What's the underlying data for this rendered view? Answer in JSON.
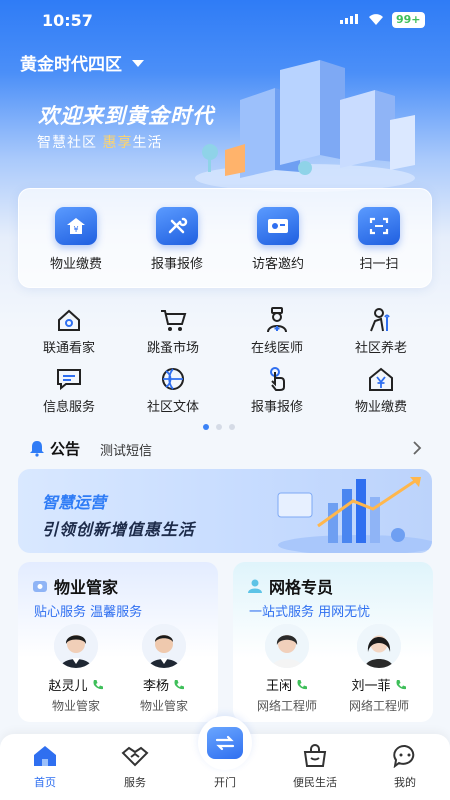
{
  "status": {
    "time": "10:57",
    "battery": "99+"
  },
  "header": {
    "community": "黄金时代四区",
    "welcome": "欢迎来到黄金时代",
    "slogan_a": "智慧社区",
    "slogan_hl": "惠享",
    "slogan_b": "生活"
  },
  "quick_actions": [
    {
      "label": "物业缴费",
      "icon": "property-fee-icon"
    },
    {
      "label": "报事报修",
      "icon": "repair-tools-icon"
    },
    {
      "label": "访客邀约",
      "icon": "visitor-card-icon"
    },
    {
      "label": "扫一扫",
      "icon": "scan-icon"
    }
  ],
  "services": [
    {
      "label": "联通看家",
      "icon": "home-camera-icon"
    },
    {
      "label": "跳蚤市场",
      "icon": "shopping-cart-icon"
    },
    {
      "label": "在线医师",
      "icon": "doctor-icon"
    },
    {
      "label": "社区养老",
      "icon": "elderly-care-icon"
    },
    {
      "label": "信息服务",
      "icon": "message-icon"
    },
    {
      "label": "社区文体",
      "icon": "basketball-icon"
    },
    {
      "label": "报事报修",
      "icon": "tap-hand-icon"
    },
    {
      "label": "物业缴费",
      "icon": "house-yuan-icon"
    }
  ],
  "notice": {
    "title": "公告",
    "text": "测试短信"
  },
  "banner": {
    "line1": "智慧运营",
    "line2": "引领创新增值惠生活"
  },
  "manager_card": {
    "title": "物业管家",
    "subtitle": "贴心服务 温馨服务",
    "people": [
      {
        "name": "赵灵儿",
        "role": "物业管家"
      },
      {
        "name": "李杨",
        "role": "物业管家"
      }
    ]
  },
  "network_card": {
    "title": "网格专员",
    "subtitle": "一站式服务 用网无忧",
    "people": [
      {
        "name": "王闲",
        "role": "网络工程师"
      },
      {
        "name": "刘一菲",
        "role": "网络工程师"
      }
    ]
  },
  "tabs": [
    {
      "label": "首页",
      "icon": "home-icon"
    },
    {
      "label": "服务",
      "icon": "handshake-icon"
    },
    {
      "label": "开门",
      "icon": "door-open-icon"
    },
    {
      "label": "便民生活",
      "icon": "shopping-bag-icon"
    },
    {
      "label": "我的",
      "icon": "chat-profile-icon"
    }
  ],
  "colors": {
    "primary": "#2f7cf6",
    "accent_gold": "#ffd46b",
    "call_green": "#3fbf5a"
  }
}
